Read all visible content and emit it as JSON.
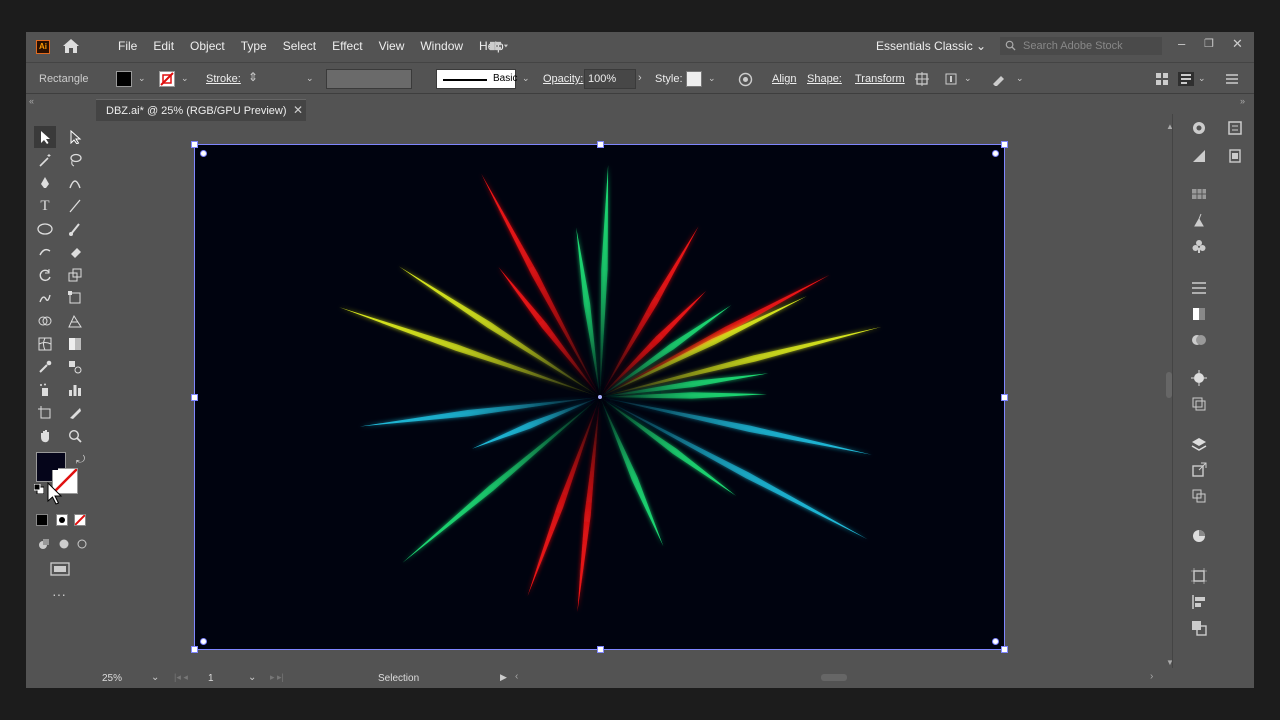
{
  "app": {
    "logo_text": "Ai"
  },
  "menubar": {
    "items": [
      "File",
      "Edit",
      "Object",
      "Type",
      "Select",
      "Effect",
      "View",
      "Window",
      "Help"
    ],
    "workspace": "Essentials Classic",
    "search_placeholder": "Search Adobe Stock"
  },
  "control": {
    "selection_type": "Rectangle",
    "stroke_label": "Stroke:",
    "profile_label": "Basic",
    "opacity_label": "Opacity:",
    "opacity_value": "100%",
    "style_label": "Style:",
    "align_label": "Align",
    "shape_label": "Shape:",
    "transform_label": "Transform",
    "fill_color": "#000000"
  },
  "document": {
    "tab_title": "DBZ.ai* @ 25% (RGB/GPU Preview)"
  },
  "status": {
    "zoom": "25%",
    "artboard_number": "1",
    "current_tool": "Selection"
  },
  "colors": {
    "artboard_bg": "#00030f",
    "selection": "#7f86ff",
    "red": "#ff1414",
    "green": "#1ee87a",
    "yellow": "#e6f51e",
    "cyan": "#21c6e6"
  }
}
